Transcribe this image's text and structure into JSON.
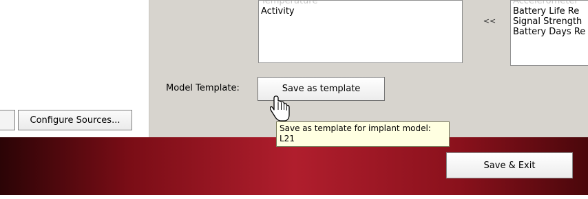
{
  "lists": {
    "left": [
      "Temperature",
      "Activity"
    ],
    "right": [
      "Accelerometer",
      "Battery Life Re",
      "Signal Strength",
      "Battery Days Re"
    ]
  },
  "buttons": {
    "move_left": "<<",
    "save_template": "Save as template",
    "configure_sources": "Configure Sources...",
    "save_exit": "Save & Exit"
  },
  "labels": {
    "model_template": "Model Template:"
  },
  "tooltip": {
    "line1": "Save as template for implant model:",
    "line2": "L21"
  }
}
